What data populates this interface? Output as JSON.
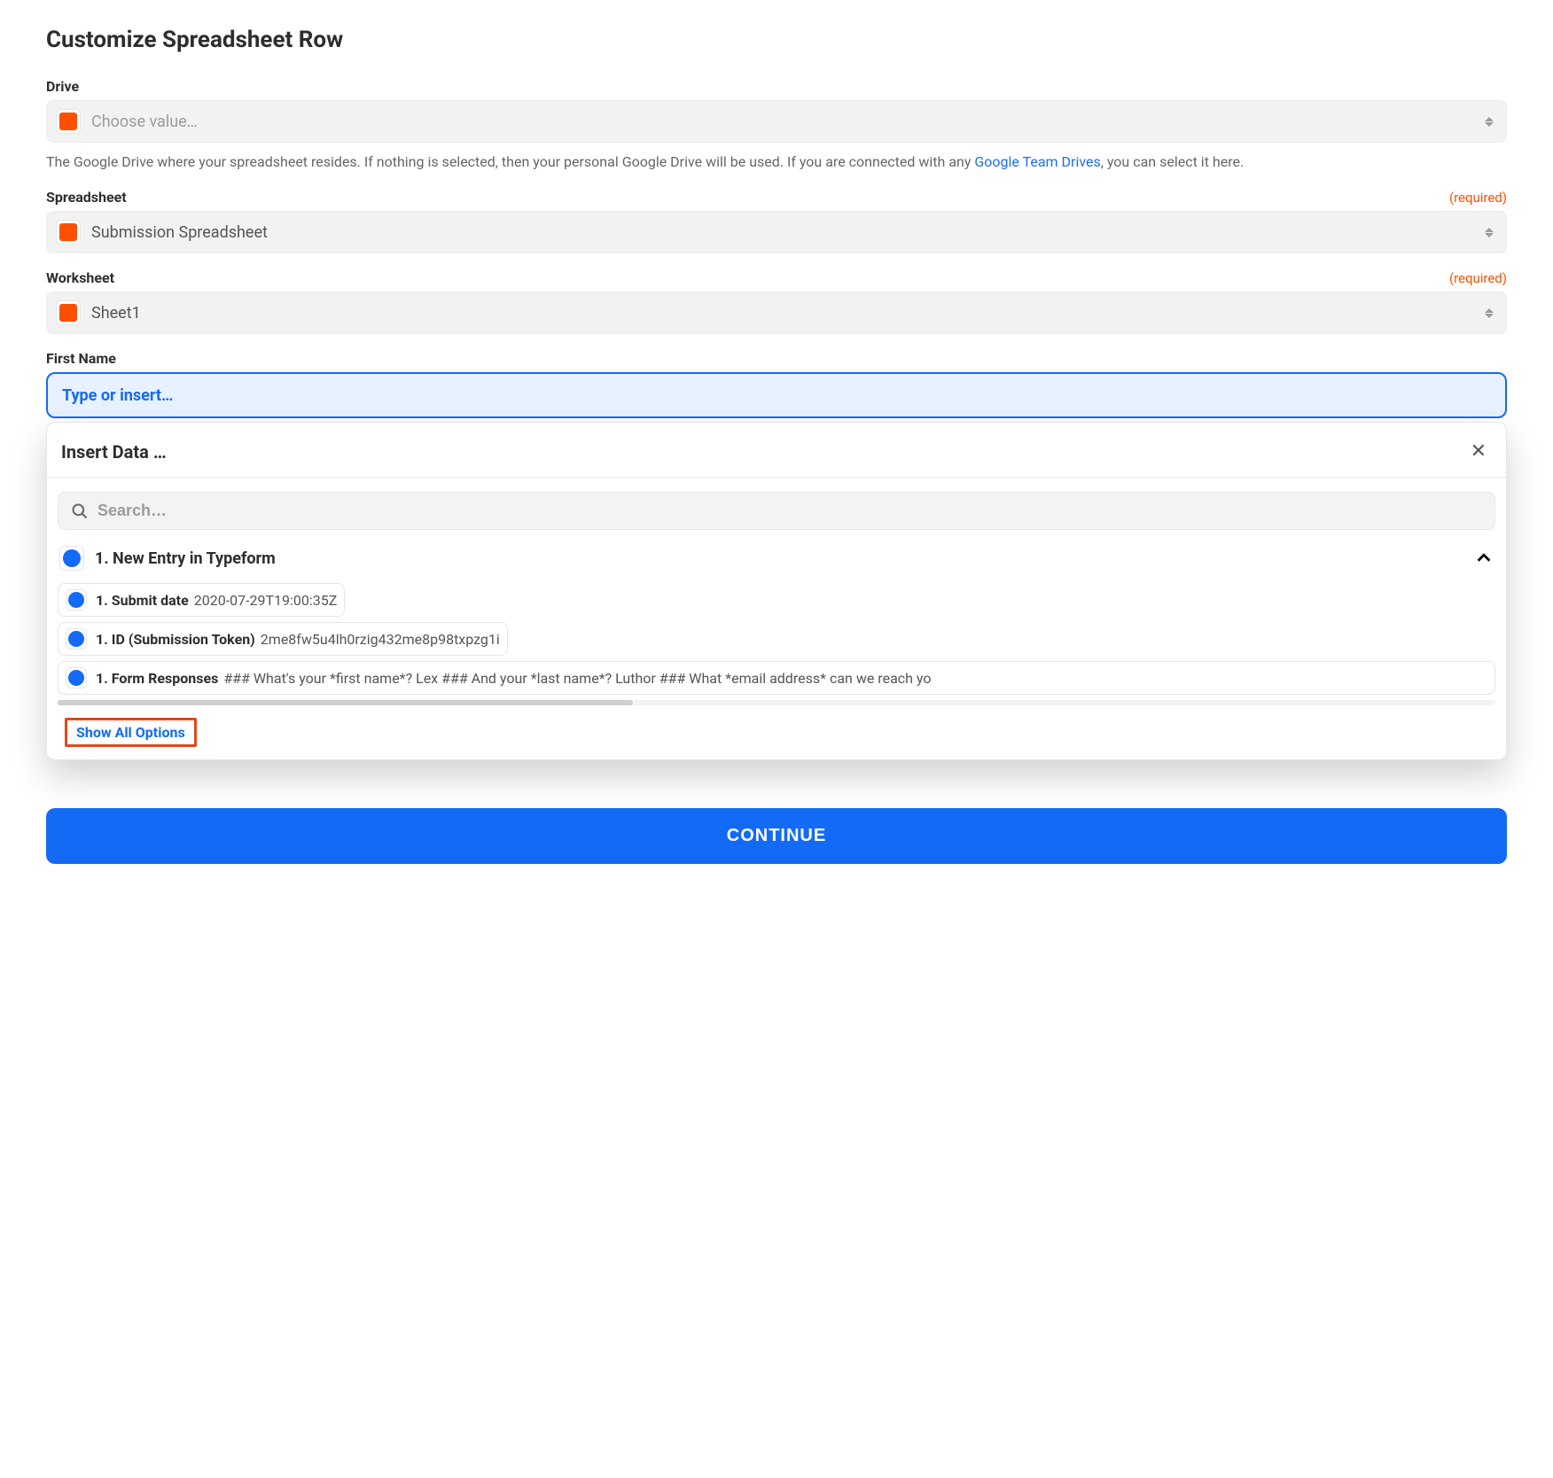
{
  "title": "Customize Spreadsheet Row",
  "fields": {
    "drive": {
      "label": "Drive",
      "placeholder": "Choose value…",
      "help_pre": "The Google Drive where your spreadsheet resides. If nothing is selected, then your personal Google Drive will be used. If you are connected with any ",
      "help_link": "Google Team Drives",
      "help_post": ", you can select it here."
    },
    "spreadsheet": {
      "label": "Spreadsheet",
      "required_text": "(required)",
      "value": "Submission Spreadsheet"
    },
    "worksheet": {
      "label": "Worksheet",
      "required_text": "(required)",
      "value": "Sheet1"
    },
    "first_name": {
      "label": "First Name",
      "placeholder": "Type or insert…"
    }
  },
  "dropdown": {
    "title": "Insert Data …",
    "search_placeholder": "Search…",
    "group_title": "1. New Entry in Typeform",
    "options": [
      {
        "label": "1. Submit date",
        "value": "2020-07-29T19:00:35Z"
      },
      {
        "label": "1. ID (Submission Token)",
        "value": "2me8fw5u4lh0rzig432me8p98txpzg1i"
      },
      {
        "label": "1. Form Responses",
        "value": "### What's your *first name*? Lex ### And your *last name*? Luthor ### What *email address* can we reach yo"
      }
    ],
    "show_all": "Show All Options"
  },
  "continue": "CONTINUE"
}
